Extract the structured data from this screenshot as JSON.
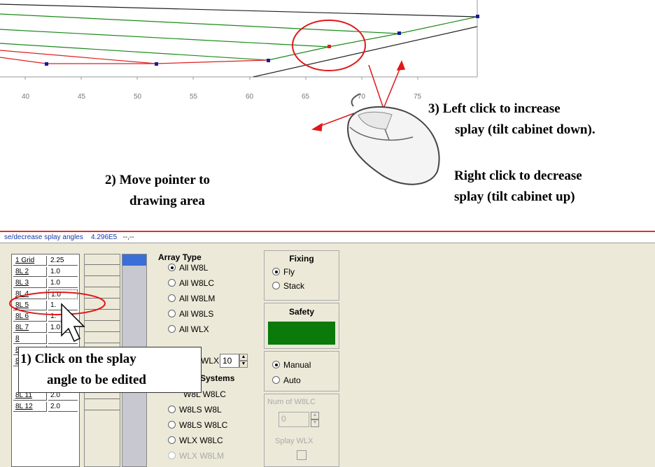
{
  "plot": {
    "x_ticks": [
      "40",
      "45",
      "50",
      "55",
      "60",
      "65",
      "70",
      "75"
    ]
  },
  "callouts": {
    "move_pointer_line1": "2) Move pointer to",
    "move_pointer_line2": "drawing area",
    "left_click_line1": "3) Left click to increase",
    "left_click_line2": "splay (tilt cabinet down).",
    "right_click_line1": "Right click to decrease",
    "right_click_line2": "splay (tilt cabinet up)",
    "click_splay_line1": "1) Click on the splay",
    "click_splay_line2": "angle to be edited"
  },
  "statusbar": {
    "text": "se/decrease splay angles",
    "value": "4.296E5",
    "suffix": "--,--"
  },
  "cabinet_table": {
    "rows": [
      {
        "name": "1 Grid",
        "value": "2.25"
      },
      {
        "name": "8L 2",
        "value": "1.0"
      },
      {
        "name": "8L 3",
        "value": "1.0"
      },
      {
        "name": "8L 4",
        "value": "1.0"
      },
      {
        "name": "8L 5",
        "value": "1."
      },
      {
        "name": "8L 6",
        "value": "1."
      },
      {
        "name": "8L 7",
        "value": "1.0"
      },
      {
        "name": "8",
        "value": ""
      },
      {
        "name": "8",
        "value": ""
      },
      {
        "name": "8",
        "value": ""
      },
      {
        "name": "8L 11",
        "value": "2.0"
      },
      {
        "name": "8L 12",
        "value": "2.0"
      }
    ]
  },
  "array_type": {
    "title": "Array Type",
    "options": [
      "All W8L",
      "All W8LC",
      "All W8LM",
      "All W8LS",
      "All WLX"
    ],
    "selected": "All W8L",
    "wlx_label": "WLX",
    "wlx_value": "10",
    "systems_title": "Systems",
    "systems_options": [
      "W8L W8LC",
      "W8LS W8L",
      "W8LS W8LC",
      "WLX W8LC",
      "WLX W8LM"
    ]
  },
  "fixing": {
    "title": "Fixing",
    "options": [
      "Fly",
      "Stack"
    ],
    "selected": "Fly"
  },
  "safety": {
    "title": "Safety",
    "color": "#0a7a0a"
  },
  "mode": {
    "options": [
      "Manual",
      "Auto"
    ],
    "selected": "Manual"
  },
  "num_w8lc": {
    "label": "Num of W8LC",
    "value": "0"
  },
  "splay_wlx": {
    "label": "Splay WLX"
  },
  "colors": {
    "green_line": "#1a8a1a",
    "red_line": "#e02020",
    "annotation_red": "#e01818",
    "point_blue": "#1a1aa0"
  }
}
